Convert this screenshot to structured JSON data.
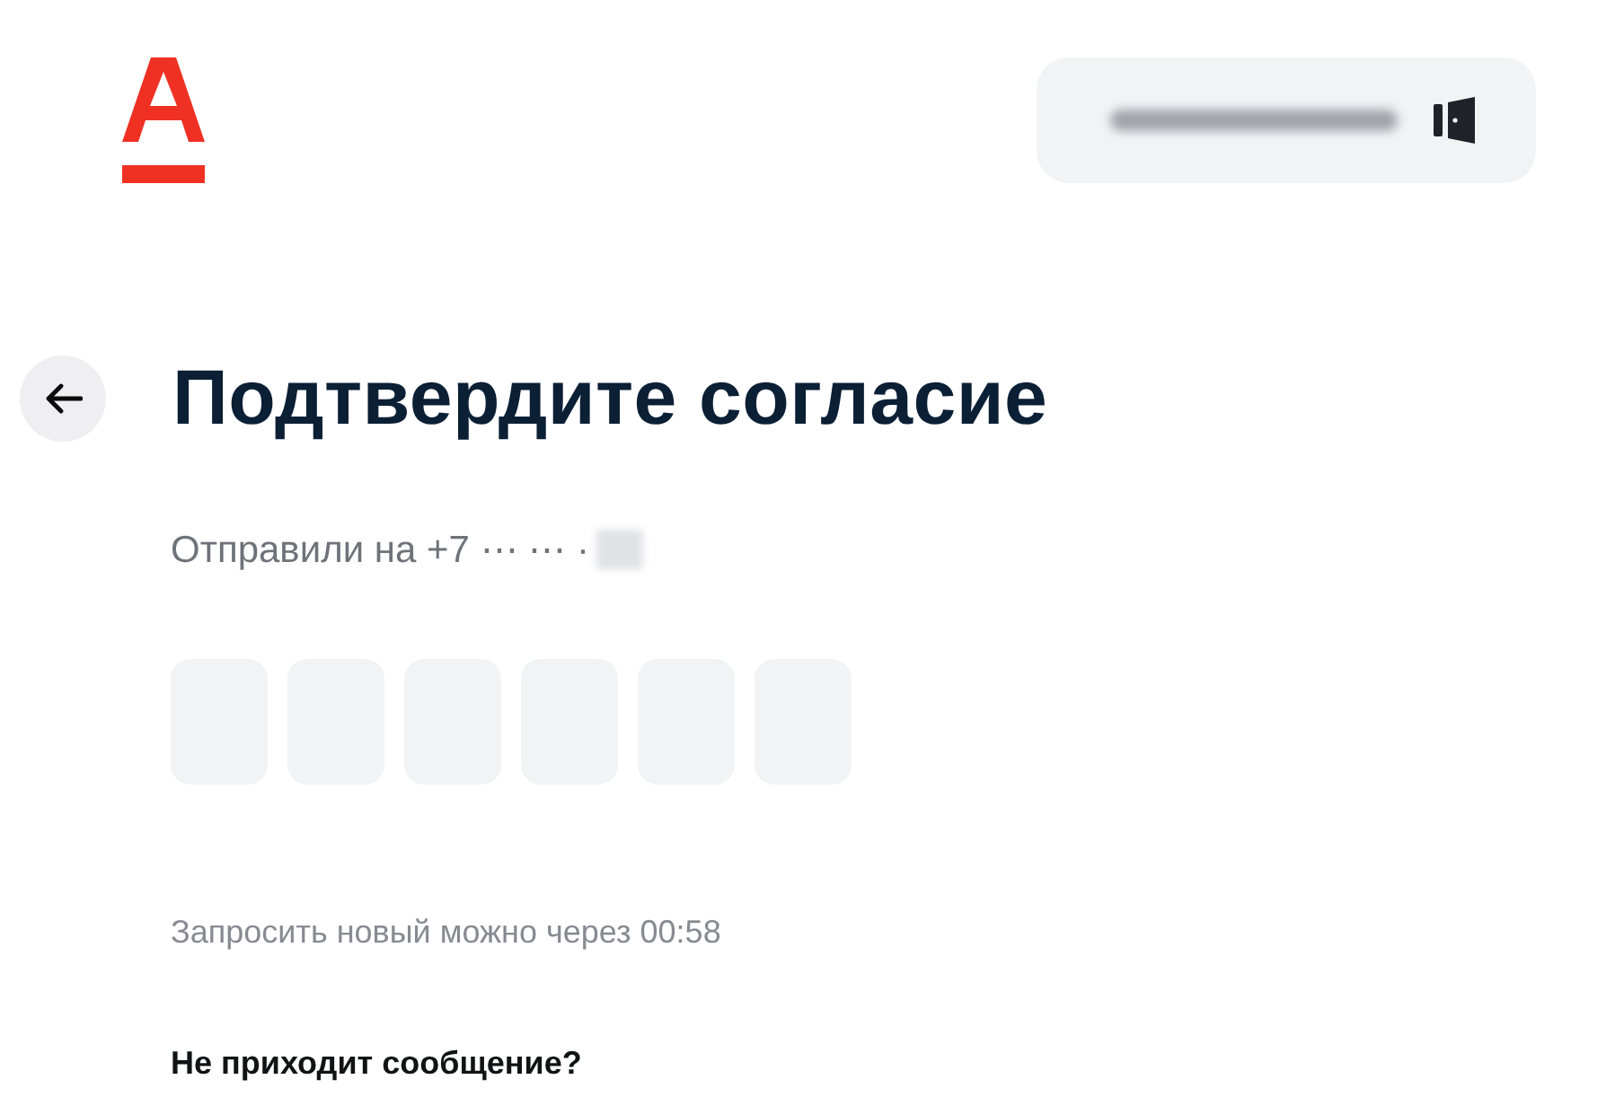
{
  "header": {
    "account_button": {
      "kind": "logout"
    }
  },
  "title": "Подтвердите согласие",
  "sent_to": "Отправили на +7 ⋯ ⋯ ·",
  "code_cells": [
    {
      "filled": false
    },
    {
      "filled": false
    },
    {
      "filled": false
    },
    {
      "filled": false
    },
    {
      "filled": false
    },
    {
      "filled": false
    }
  ],
  "resend_hint": "Запросить новый можно через 00:58",
  "help_link": "Не приходит сообщение?"
}
